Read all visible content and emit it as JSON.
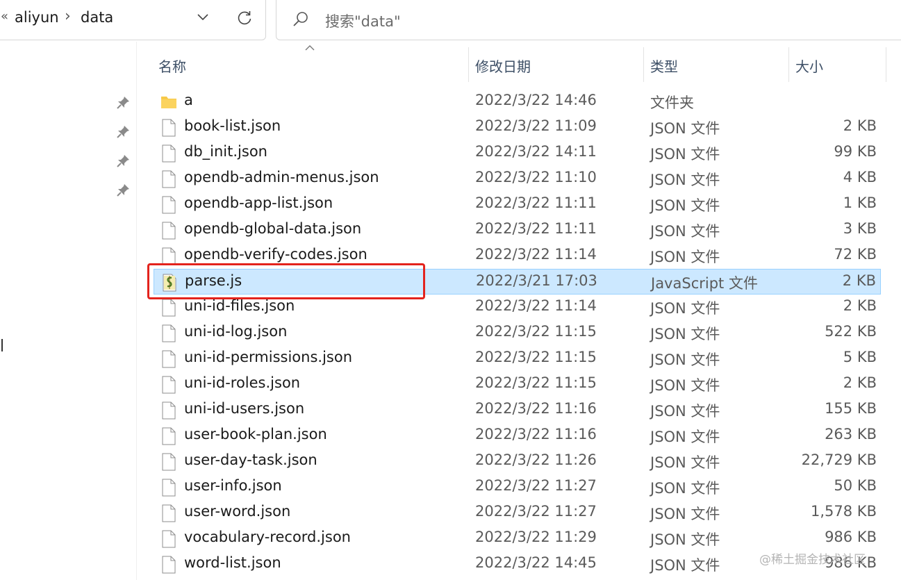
{
  "address_bar": {
    "overflow_glyph": "«",
    "crumbs": [
      "aliyun",
      "data"
    ],
    "separator": "›"
  },
  "search": {
    "placeholder": "搜索\"data\""
  },
  "columns": {
    "name": "名称",
    "date": "修改日期",
    "type": "类型",
    "size": "大小"
  },
  "files": [
    {
      "name": "a",
      "date": "2022/3/22 14:46",
      "type": "文件夹",
      "size": "",
      "icon": "folder-icon"
    },
    {
      "name": "book-list.json",
      "date": "2022/3/22 11:09",
      "type": "JSON 文件",
      "size": "2 KB",
      "icon": "file-icon"
    },
    {
      "name": "db_init.json",
      "date": "2022/3/22 14:11",
      "type": "JSON 文件",
      "size": "99 KB",
      "icon": "file-icon"
    },
    {
      "name": "opendb-admin-menus.json",
      "date": "2022/3/22 11:10",
      "type": "JSON 文件",
      "size": "4 KB",
      "icon": "file-icon"
    },
    {
      "name": "opendb-app-list.json",
      "date": "2022/3/22 11:11",
      "type": "JSON 文件",
      "size": "1 KB",
      "icon": "file-icon"
    },
    {
      "name": "opendb-global-data.json",
      "date": "2022/3/22 11:11",
      "type": "JSON 文件",
      "size": "3 KB",
      "icon": "file-icon"
    },
    {
      "name": "opendb-verify-codes.json",
      "date": "2022/3/22 11:14",
      "type": "JSON 文件",
      "size": "72 KB",
      "icon": "file-icon"
    },
    {
      "name": "parse.js",
      "date": "2022/3/21 17:03",
      "type": "JavaScript 文件",
      "size": "2 KB",
      "icon": "script-file-icon",
      "selected": true
    },
    {
      "name": "uni-id-files.json",
      "date": "2022/3/22 11:14",
      "type": "JSON 文件",
      "size": "2 KB",
      "icon": "file-icon"
    },
    {
      "name": "uni-id-log.json",
      "date": "2022/3/22 11:15",
      "type": "JSON 文件",
      "size": "522 KB",
      "icon": "file-icon"
    },
    {
      "name": "uni-id-permissions.json",
      "date": "2022/3/22 11:15",
      "type": "JSON 文件",
      "size": "5 KB",
      "icon": "file-icon"
    },
    {
      "name": "uni-id-roles.json",
      "date": "2022/3/22 11:15",
      "type": "JSON 文件",
      "size": "2 KB",
      "icon": "file-icon"
    },
    {
      "name": "uni-id-users.json",
      "date": "2022/3/22 11:16",
      "type": "JSON 文件",
      "size": "155 KB",
      "icon": "file-icon"
    },
    {
      "name": "user-book-plan.json",
      "date": "2022/3/22 11:16",
      "type": "JSON 文件",
      "size": "263 KB",
      "icon": "file-icon"
    },
    {
      "name": "user-day-task.json",
      "date": "2022/3/22 11:26",
      "type": "JSON 文件",
      "size": "22,729 KB",
      "icon": "file-icon"
    },
    {
      "name": "user-info.json",
      "date": "2022/3/22 11:27",
      "type": "JSON 文件",
      "size": "50 KB",
      "icon": "file-icon"
    },
    {
      "name": "user-word.json",
      "date": "2022/3/22 11:27",
      "type": "JSON 文件",
      "size": "1,578 KB",
      "icon": "file-icon"
    },
    {
      "name": "vocabulary-record.json",
      "date": "2022/3/22 11:29",
      "type": "JSON 文件",
      "size": "986 KB",
      "icon": "file-icon"
    },
    {
      "name": "word-list.json",
      "date": "2022/3/22 14:45",
      "type": "JSON 文件",
      "size": "986 KB",
      "icon": "file-icon"
    }
  ],
  "watermark": "@稀土掘金技术社区",
  "colors": {
    "selection_bg": "#cce8ff",
    "selection_border": "#99d1ff",
    "annotation_red": "#e3231d",
    "folder": "#f7c948"
  }
}
